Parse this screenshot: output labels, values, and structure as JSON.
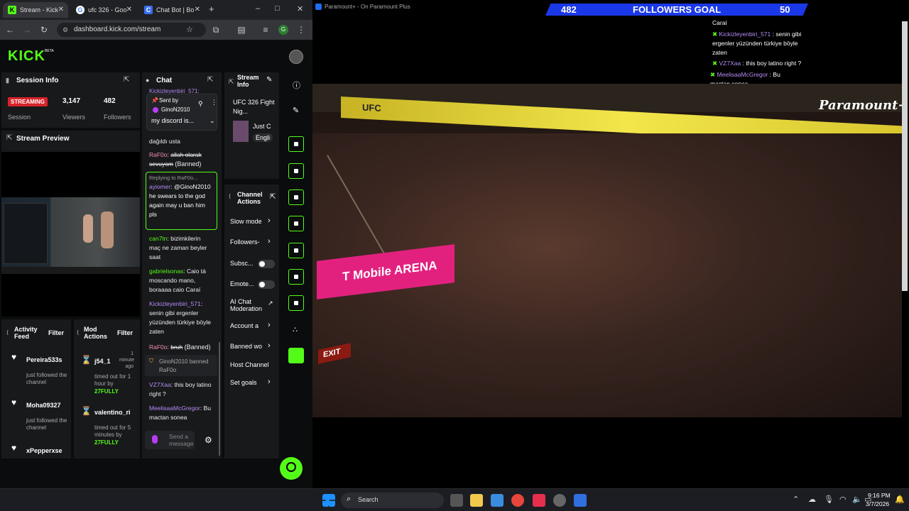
{
  "browser": {
    "tabs": [
      {
        "label": "Stream - Kick",
        "icon": "K"
      },
      {
        "label": "ufc 326 - Goo",
        "icon": "G"
      },
      {
        "label": "Chat Bot | Bo",
        "icon": "C"
      }
    ],
    "new_tab": "+",
    "address": "dashboard.kick.com/stream",
    "profile_initial": "G",
    "window_controls": [
      "–",
      "□",
      "✕"
    ]
  },
  "kick": {
    "logo": "KICK",
    "logo_badge": "BETA",
    "session": {
      "title": "Session Info",
      "status": "STREAMING",
      "status_label": "Session",
      "viewers": "3,147",
      "viewers_label": "Viewers",
      "followers": "482",
      "followers_label": "Followers"
    },
    "preview_title": "Stream Preview",
    "chat": {
      "title": "Chat",
      "pinned": {
        "sent_by": "Sent by",
        "user": "GinoN2010",
        "text": "my discord is..."
      },
      "partial_top_user": "Kickizleyenbiri_571:",
      "msgs": [
        {
          "text": "dağıldı usta"
        },
        {
          "user": "RaF0o",
          "text": "allah olarak sevuyom",
          "suffix": "(Banned)"
        },
        {
          "reply": "Replying to RaF0o...",
          "user": "ayiomer",
          "text": "@GinoN2010 he swears to the god again may u ban him pls"
        },
        {
          "user": "can7tn",
          "text": "bizimkilerin maç ne zaman beyler saat"
        },
        {
          "user": "gabrielsonas",
          "text": "Caio tá moscando mano, boraaaa caio Caraí"
        },
        {
          "user": "Kickizleyenbiri_571",
          "text": "senin gibi ergenler yüzünden türkiye böyle zaten"
        },
        {
          "user": "RaF0o",
          "text": "bruh",
          "suffix": "(Banned)"
        },
        {
          "system": "GinoN2010 banned RaF0o"
        },
        {
          "user": "VZ7Xaa",
          "text": "this boy latino right ?"
        },
        {
          "user": "MeelisaaMcGregor",
          "text": "Bu mactan sonea"
        }
      ],
      "input_placeholder": "Send a message"
    },
    "stream_info": {
      "title": "Stream Info",
      "stream_title": "UFC 326 Fight Nig...",
      "category": "Just C",
      "language": "Engli"
    },
    "channel_actions": {
      "title": "Channel Actions",
      "items": [
        "Slow mode",
        "Followers-",
        "Subsc...",
        "Emote...",
        "AI Chat Moderation",
        "Account a",
        "Banned wo",
        "Host Channel",
        "Set goals"
      ]
    },
    "activity": {
      "title": "Activity Feed",
      "filter": "Filter",
      "items": [
        {
          "name": "Pereira533s",
          "sub": "just followed the channel"
        },
        {
          "name": "Moha09327",
          "sub": "just followed the channel"
        },
        {
          "name": "xPepperxse",
          "sub": ""
        }
      ]
    },
    "mod_actions": {
      "title": "Mod Actions",
      "filter": "Filter",
      "items": [
        {
          "name": "j54_1",
          "time": "1 minute ago",
          "detail": "timed out for 1 hour by",
          "by": "27FULLY"
        },
        {
          "name": "valentino_ri",
          "time": "",
          "detail": "timed out for 5 minutes by",
          "by": "27FULLY"
        }
      ]
    }
  },
  "overlay": {
    "goal_current": "482",
    "goal_label": "FOLLOWERS GOAL",
    "goal_target": "50",
    "window_title": "Paramount+ - On Paramount Plus",
    "brand": "Paramount+",
    "arena_sign": "T Mobile ARENA",
    "ufc": "UFC",
    "exit": "EXIT",
    "chat": [
      {
        "user": "",
        "text": "Caraí"
      },
      {
        "user": "Kickizleyenbiri_571",
        "text": "senin gibi ergenler yüzünden türkiye böyle zaten"
      },
      {
        "user": "VZ7Xaa",
        "text": "this boy latino right ?"
      },
      {
        "user": "MeelisaaMcGregor",
        "text": "Bu mactan sonea"
      }
    ]
  },
  "taskbar": {
    "search": "Search",
    "time": "9:16 PM",
    "date": "3/7/2026"
  }
}
